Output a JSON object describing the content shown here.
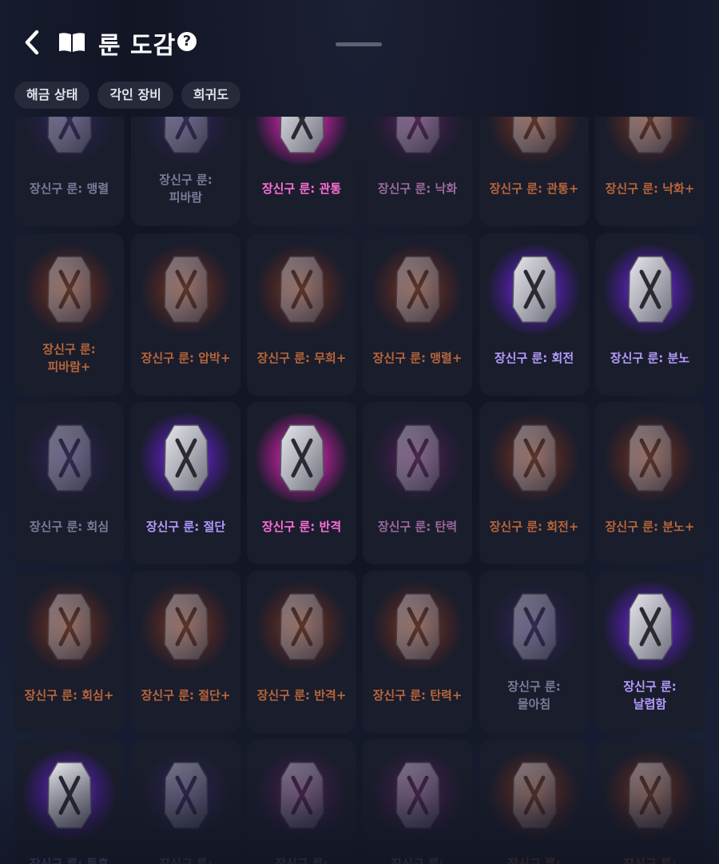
{
  "header": {
    "title": "룬 도감",
    "help_symbol": "?",
    "back_icon": "chevron-left-icon",
    "book_icon": "book-icon"
  },
  "filters": [
    "해금 상태",
    "각인 장비",
    "희귀도"
  ],
  "colors": {
    "orange": "#b8653a",
    "purple": "#b59cff",
    "pink": "#ff6fd8",
    "gray": "#7e7a99"
  },
  "runes": [
    [
      {
        "name": "장신구 룬: 맹렬",
        "tier": "gray"
      },
      {
        "name": "장신구 룬:\n피바람",
        "tier": "gray"
      },
      {
        "name": "장신구 룬: 관통",
        "tier": "pink"
      },
      {
        "name": "장신구 룬: 낙화",
        "tier": "gpink"
      },
      {
        "name": "장신구 룬: 관통+",
        "tier": "orange"
      },
      {
        "name": "장신구 룬: 낙화+",
        "tier": "orange"
      }
    ],
    [
      {
        "name": "장신구 룬:\n피바람+",
        "tier": "orange"
      },
      {
        "name": "장신구 룬: 압박+",
        "tier": "orange"
      },
      {
        "name": "장신구 룬: 무희+",
        "tier": "orange"
      },
      {
        "name": "장신구 룬: 맹렬+",
        "tier": "orange"
      },
      {
        "name": "장신구 룬: 회전",
        "tier": "purple"
      },
      {
        "name": "장신구 룬: 분노",
        "tier": "purple"
      }
    ],
    [
      {
        "name": "장신구 룬: 회심",
        "tier": "gray"
      },
      {
        "name": "장신구 룬: 절단",
        "tier": "purple"
      },
      {
        "name": "장신구 룬: 반격",
        "tier": "pink"
      },
      {
        "name": "장신구 룬: 탄력",
        "tier": "gpink"
      },
      {
        "name": "장신구 룬: 회전+",
        "tier": "orange"
      },
      {
        "name": "장신구 룬: 분노+",
        "tier": "orange"
      }
    ],
    [
      {
        "name": "장신구 룬: 회심+",
        "tier": "orange"
      },
      {
        "name": "장신구 룬: 절단+",
        "tier": "orange"
      },
      {
        "name": "장신구 룬: 반격+",
        "tier": "orange"
      },
      {
        "name": "장신구 룬: 탄력+",
        "tier": "orange"
      },
      {
        "name": "장신구 룬:\n몰아침",
        "tier": "gray"
      },
      {
        "name": "장신구 룬:\n날렵함",
        "tier": "purple"
      }
    ],
    [
      {
        "name": "장신구 룬: 투혼",
        "tier": "purple"
      },
      {
        "name": "장신구 룬:",
        "tier": "gray"
      },
      {
        "name": "장신구 룬:",
        "tier": "gpink"
      },
      {
        "name": "장신구 룬:",
        "tier": "gpink"
      },
      {
        "name": "장신구 룬:",
        "tier": "orange"
      },
      {
        "name": "장신구 룬:",
        "tier": "orange"
      }
    ]
  ],
  "unlocked": [
    [
      false,
      false,
      true,
      false,
      false,
      false
    ],
    [
      false,
      false,
      false,
      false,
      true,
      true
    ],
    [
      false,
      true,
      true,
      false,
      false,
      false
    ],
    [
      false,
      false,
      false,
      false,
      false,
      true
    ],
    [
      true,
      false,
      false,
      false,
      false,
      false
    ]
  ]
}
